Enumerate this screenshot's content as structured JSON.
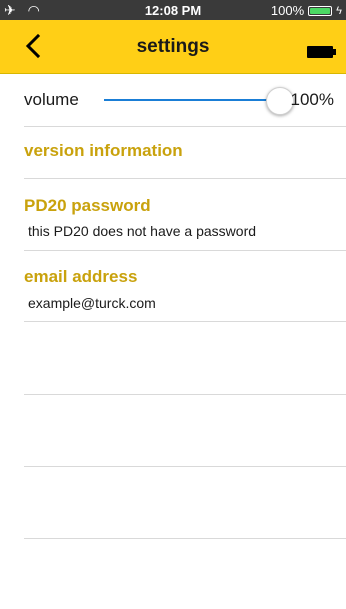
{
  "status": {
    "time": "12:08 PM",
    "battery_pct": "100%",
    "battery_color": "#4cd964"
  },
  "header": {
    "title": "settings",
    "back_icon": "chevron-left-icon",
    "battery_icon": "battery-full-icon",
    "color": "#ffcf16"
  },
  "volume": {
    "label": "volume",
    "value_text": "100%",
    "level": 1.0,
    "accent": "#1a7ed6"
  },
  "version": {
    "label": "version information"
  },
  "password": {
    "label": "PD20 password",
    "text": "this PD20 does not have a password"
  },
  "email": {
    "label": "email address",
    "text": "example@turck.com"
  },
  "section_color": "#c9a20d"
}
